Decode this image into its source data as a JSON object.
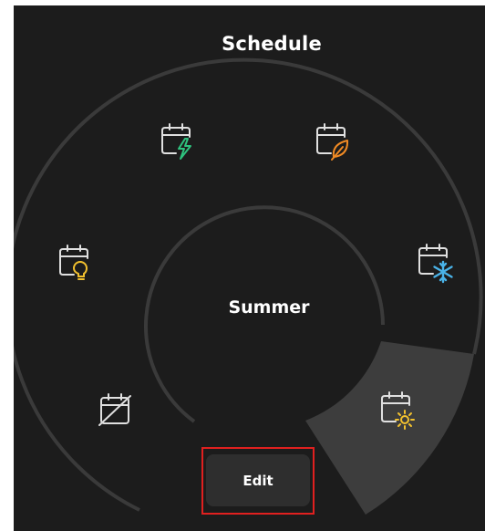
{
  "header": {
    "title": "Schedule"
  },
  "dial": {
    "active_mode": "Summer",
    "modes": [
      {
        "name": "off",
        "icon": "calendar-off-icon",
        "color": "#e0e0e0"
      },
      {
        "name": "lighting",
        "icon": "calendar-lightbulb-icon",
        "color": "#f2c12e"
      },
      {
        "name": "energy",
        "icon": "calendar-lightning-icon",
        "color": "#2ec27e"
      },
      {
        "name": "autumn",
        "icon": "calendar-leaf-icon",
        "color": "#f08a24"
      },
      {
        "name": "winter",
        "icon": "calendar-snowflake-icon",
        "color": "#4ab3e8"
      },
      {
        "name": "summer",
        "icon": "calendar-sun-icon",
        "color": "#f2c12e",
        "selected": true
      }
    ]
  },
  "actions": {
    "edit_label": "Edit"
  },
  "colors": {
    "background": "#1c1c1c",
    "ring": "#3a3a3a",
    "selected_sector": "#3d3d3d",
    "highlight_border": "#e0201f"
  }
}
